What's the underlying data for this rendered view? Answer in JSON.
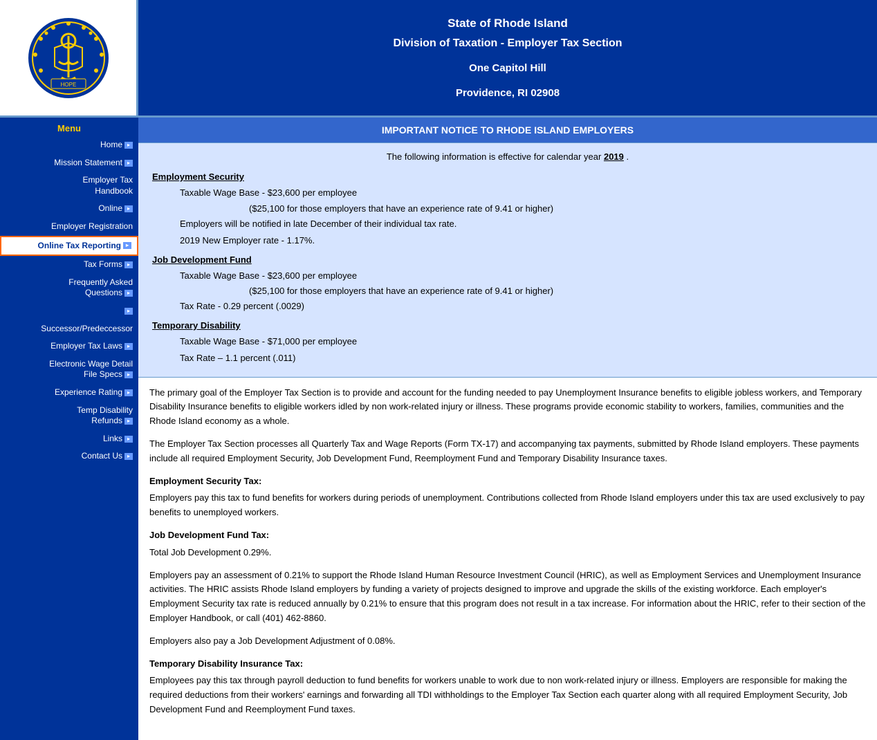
{
  "header": {
    "line1": "State of Rhode Island",
    "line2": "Division of Taxation - Employer Tax Section",
    "line3": "One Capitol Hill",
    "line4": "Providence, RI 02908"
  },
  "sidebar": {
    "menu_label": "Menu",
    "items": [
      {
        "id": "home",
        "label": "Home",
        "has_icon": true,
        "active": false
      },
      {
        "id": "mission-statement",
        "label": "Mission Statement",
        "has_icon": true,
        "active": false
      },
      {
        "id": "employer-tax-handbook",
        "label": "Employer Tax\nHandbook",
        "has_icon": false,
        "active": false
      },
      {
        "id": "online",
        "label": "Online",
        "has_icon": true,
        "active": false
      },
      {
        "id": "employer-registration",
        "label": "Employer Registration",
        "has_icon": false,
        "active": false
      },
      {
        "id": "online-tax-reporting",
        "label": "Online Tax Reporting",
        "has_icon": true,
        "active": true
      },
      {
        "id": "tax-forms",
        "label": "Tax Forms",
        "has_icon": true,
        "active": false
      },
      {
        "id": "faq",
        "label": "Frequently Asked\nQuestions",
        "has_icon": true,
        "active": false
      },
      {
        "id": "icon-only",
        "label": "",
        "has_icon": true,
        "active": false
      },
      {
        "id": "successor",
        "label": "Successor/Predeccessor",
        "has_icon": false,
        "active": false
      },
      {
        "id": "employer-tax-laws",
        "label": "Employer Tax Laws",
        "has_icon": true,
        "active": false
      },
      {
        "id": "electronic-wage",
        "label": "Electronic Wage Detail\nFile Specs",
        "has_icon": true,
        "active": false
      },
      {
        "id": "experience-rating",
        "label": "Experience Rating",
        "has_icon": true,
        "active": false
      },
      {
        "id": "temp-disability",
        "label": "Temp Disability\nRefunds",
        "has_icon": true,
        "active": false
      },
      {
        "id": "links",
        "label": "Links",
        "has_icon": true,
        "active": false
      },
      {
        "id": "contact-us",
        "label": "Contact Us",
        "has_icon": true,
        "active": false
      }
    ]
  },
  "notice": {
    "header": "IMPORTANT NOTICE TO RHODE ISLAND EMPLOYERS",
    "year_text": "The following information is effective for calendar year",
    "year": "2019",
    "year_suffix": ".",
    "sections": [
      {
        "id": "employment-security",
        "heading": "Employment Security",
        "items": [
          "Taxable Wage Base - $23,600 per employee",
          "($25,100 for those employers that have an experience rate of 9.41 or higher)",
          "",
          "Employers will be notified in late December of their individual tax rate.",
          "",
          "2019 New Employer rate - 1.17%."
        ]
      },
      {
        "id": "job-development-fund",
        "heading": "Job Development Fund",
        "items": [
          "Taxable Wage Base - $23,600 per employee",
          "($25,100 for those employers that have an experience rate of 9.41 or higher)",
          "",
          "Tax Rate - 0.29 percent (.0029)"
        ]
      },
      {
        "id": "temporary-disability",
        "heading": "Temporary Disability",
        "items": [
          "Taxable Wage Base - $71,000 per employee",
          "",
          "Tax Rate – 1.1 percent (.011)"
        ]
      }
    ]
  },
  "body_paragraphs": [
    {
      "id": "p1",
      "text": "The primary goal of the Employer Tax Section is to provide and account for the funding needed to pay Unemployment Insurance benefits to eligible jobless workers, and Temporary Disability Insurance benefits to eligible workers idled by non work-related injury or illness. These programs provide economic stability to workers, families, communities and the Rhode Island economy as a whole."
    },
    {
      "id": "p2",
      "text": "The Employer Tax Section processes all Quarterly Tax and Wage Reports (Form TX-17) and accompanying tax payments, submitted by Rhode Island employers. These payments include all required Employment Security, Job Development Fund, Reemployment Fund and Temporary Disability Insurance taxes."
    },
    {
      "id": "heading-employment-security-tax",
      "heading": "Employment Security Tax:",
      "text": "Employers pay this tax to fund benefits for workers during periods of unemployment. Contributions collected from Rhode Island employers under this tax are used exclusively to pay benefits to unemployed workers."
    },
    {
      "id": "heading-job-development-fund-tax",
      "heading": "Job Development Fund Tax:",
      "text": "Total Job Development 0.29%."
    },
    {
      "id": "p3",
      "text": "Employers pay an assessment of 0.21% to support the Rhode Island Human Resource Investment Council (HRIC), as well as Employment Services and Unemployment Insurance activities. The HRIC assists Rhode Island employers by funding a variety of projects designed to improve and upgrade the skills of the existing workforce. Each employer's Employment Security tax rate is reduced annually by 0.21% to ensure that this program does not result in a tax increase. For information about the HRIC, refer to their section of the Employer Handbook, or call (401) 462-8860."
    },
    {
      "id": "p4",
      "text": "Employers also pay a Job Development Adjustment of 0.08%."
    },
    {
      "id": "heading-temporary-disability-tax",
      "heading": "Temporary Disability Insurance Tax:",
      "text": "Employees pay this tax through payroll deduction to fund benefits for workers unable to work due to non work-related injury or illness. Employers are responsible for making the required deductions from their workers' earnings and forwarding all TDI withholdings to the Employer Tax Section each quarter along with all required Employment Security, Job Development Fund and Reemployment Fund taxes."
    }
  ],
  "colors": {
    "header_bg": "#003399",
    "sidebar_bg": "#003399",
    "notice_header_bg": "#3366cc",
    "notice_body_bg": "#d6e4ff",
    "menu_label": "#ffcc00",
    "active_border": "#ff6600"
  }
}
